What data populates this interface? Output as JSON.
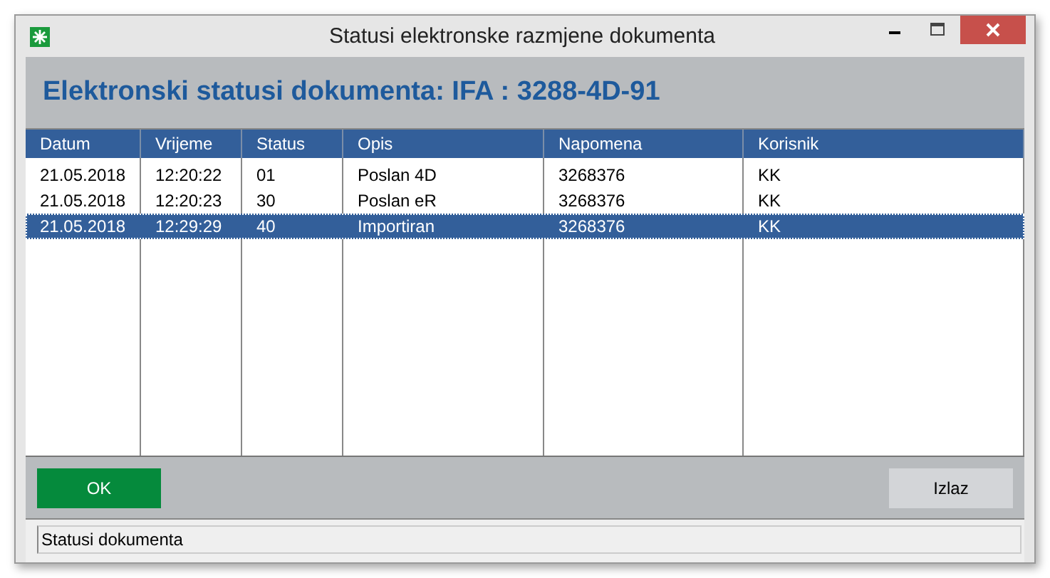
{
  "window": {
    "title": "Statusi elektronske razmjene dokumenta"
  },
  "heading": "Elektronski statusi dokumenta: IFA : 3288-4D-91",
  "table": {
    "columns": [
      "Datum",
      "Vrijeme",
      "Status",
      "Opis",
      "Napomena",
      "Korisnik"
    ],
    "rows": [
      {
        "cells": [
          "21.05.2018",
          "12:20:22",
          "01",
          "Poslan 4D",
          "3268376",
          "KK"
        ],
        "selected": false
      },
      {
        "cells": [
          "21.05.2018",
          "12:20:23",
          "30",
          "Poslan eR",
          "3268376",
          "KK"
        ],
        "selected": false
      },
      {
        "cells": [
          "21.05.2018",
          "12:29:29",
          "40",
          "Importiran",
          "3268376",
          "KK"
        ],
        "selected": true
      }
    ]
  },
  "buttons": [
    {
      "label": "OK",
      "kind": "primary"
    },
    {
      "label": "Izlaz",
      "kind": "secondary"
    }
  ],
  "status_bar": "Statusi dokumenta"
}
